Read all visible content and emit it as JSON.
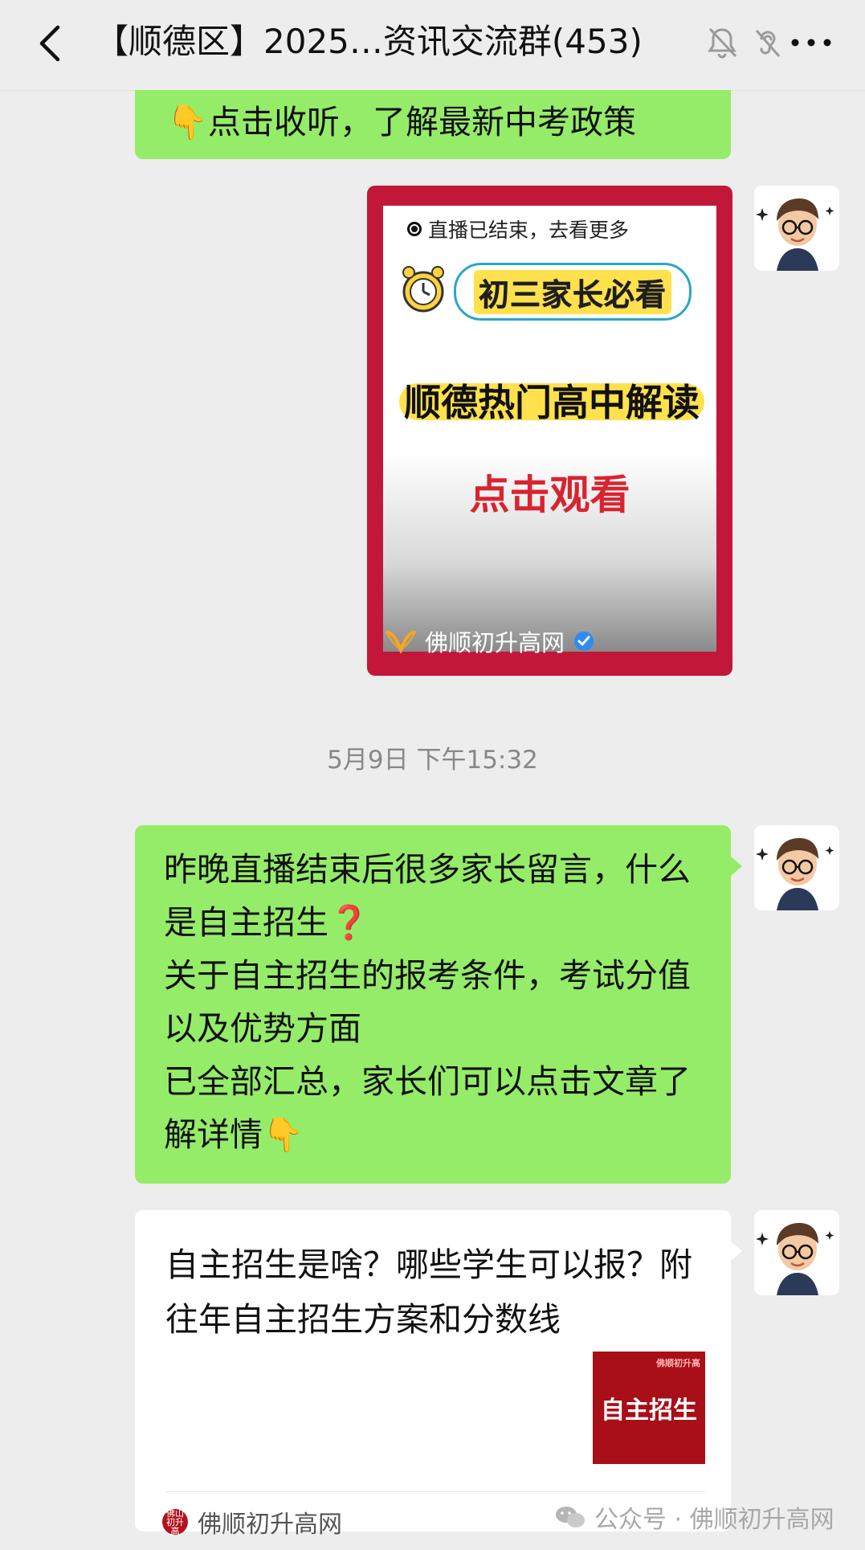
{
  "header": {
    "title": "【顺德区】2025…资讯交流群(453)"
  },
  "messages": {
    "partial_text": "👇点击收听，了解最新中考政策",
    "video": {
      "live_status": "直播已结束，去看更多",
      "tag": "初三家长必看",
      "headline": "顺德热门高中解读",
      "cta": "点击观看",
      "channel": "佛顺初升高网"
    },
    "timestamp": "5月9日 下午15:32",
    "long_text": "昨晚直播结束后很多家长留言，什么是自主招生❓\n关于自主招生的报考条件，考试分值以及优势方面\n已全部汇总，家长们可以点击文章了解详情👇",
    "article": {
      "title": "自主招生是啥？哪些学生可以报？附往年自主招生方案和分数线",
      "thumb_text": "自主招生",
      "thumb_small": "佛顺初升高",
      "source": "佛顺初升高网",
      "source_logo": "佛山初升高"
    }
  },
  "watermark": "公众号 · 佛顺初升高网",
  "colors": {
    "bubble_green": "#95ec69",
    "background": "#ededed",
    "video_frame": "#c3173a"
  }
}
